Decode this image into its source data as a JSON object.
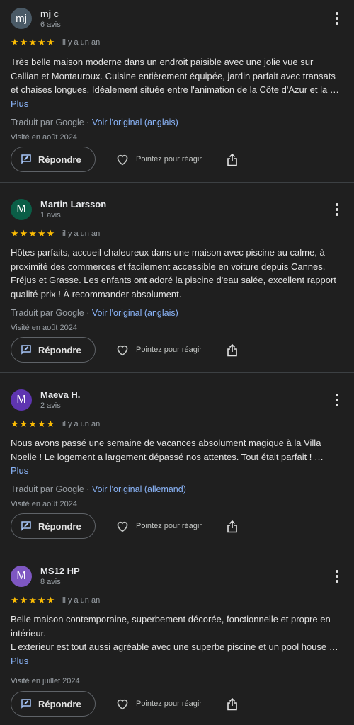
{
  "reviews": [
    {
      "avatar_letter": "mj",
      "avatar_color": "#4a5a66",
      "name": "mj c",
      "count": "6 avis",
      "rating": 5,
      "time": "il y a un an",
      "text": "Très belle maison moderne dans un endroit paisible avec une jolie vue sur Callian et Montauroux. Cuisine entièrement équipée, jardin parfait avec transats et chaises longues. Idéalement située entre l'animation de la Côte d'Azur et la …",
      "more": "Plus",
      "translated_by": "Traduit par Google",
      "original_link": "Voir l'original (anglais)",
      "visited": "Visité en août 2024"
    },
    {
      "avatar_letter": "M",
      "avatar_color": "#0b5e47",
      "name": "Martin Larsson",
      "count": "1 avis",
      "rating": 5,
      "time": "il y a un an",
      "text": "Hôtes parfaits, accueil chaleureux dans une maison avec piscine au calme, à proximité des commerces et facilement accessible en voiture depuis Cannes, Fréjus et Grasse. Les enfants ont adoré la piscine d'eau salée, excellent rapport qualité-prix ! À recommander absolument.",
      "more": "",
      "translated_by": "Traduit par Google",
      "original_link": "Voir l'original (anglais)",
      "visited": "Visité en août 2024"
    },
    {
      "avatar_letter": "M",
      "avatar_color": "#5e35b1",
      "name": "Maeva H.",
      "count": "2 avis",
      "rating": 5,
      "time": "il y a un an",
      "text": "Nous avons passé une semaine de vacances absolument magique à la Villa Noelie ! Le logement a largement dépassé nos attentes. Tout était parfait ! …",
      "more": "Plus",
      "translated_by": "Traduit par Google",
      "original_link": "Voir l'original (allemand)",
      "visited": "Visité en août 2024"
    },
    {
      "avatar_letter": "M",
      "avatar_color": "#7e57c2",
      "name": "MS12 HP",
      "count": "8 avis",
      "rating": 5,
      "time": "il y a un an",
      "text_lines": [
        "Belle maison contemporaine, superbement décorée, fonctionnelle et propre en intérieur.",
        "L exterieur est tout aussi agréable avec une superbe piscine et un pool house …"
      ],
      "more": "Plus",
      "visited": "Visité en juillet 2024"
    }
  ],
  "actions": {
    "reply_label": "Répondre",
    "react_label": "Pointez pour réagir"
  },
  "icons": {
    "reply": "reply-edit-icon",
    "react": "heart-outline-icon",
    "share": "share-icon",
    "menu": "more-vert-icon",
    "star": "star-icon"
  },
  "colors": {
    "star": "#fbbc04",
    "link": "#8ab4f8",
    "background": "#1f1f1f"
  }
}
